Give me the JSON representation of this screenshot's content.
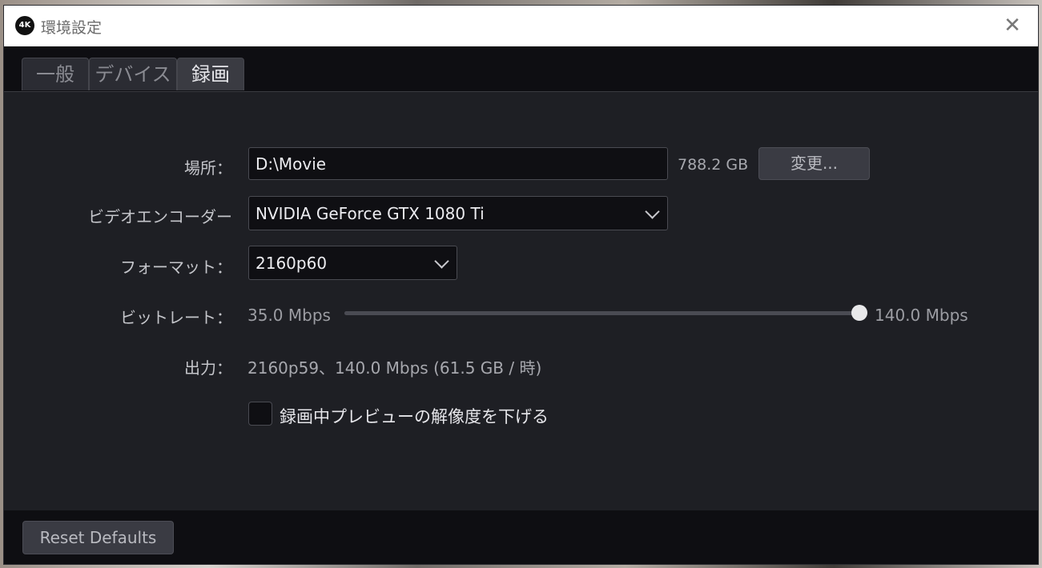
{
  "window": {
    "app_icon_text": "4K",
    "title": "環境設定",
    "close_glyph": "✕"
  },
  "tabs": [
    {
      "label": "一般",
      "active": false
    },
    {
      "label": "デバイス",
      "active": false
    },
    {
      "label": "録画",
      "active": true
    }
  ],
  "form": {
    "location": {
      "label": "場所：",
      "value": "D:\\Movie",
      "free_space": "788.2 GB",
      "change_button": "変更..."
    },
    "encoder": {
      "label": "ビデオエンコーダー",
      "value": "NVIDIA GeForce GTX 1080 Ti"
    },
    "format": {
      "label": "フォーマット：",
      "value": "2160p60"
    },
    "bitrate": {
      "label": "ビットレート：",
      "min_label": "35.0 Mbps",
      "max_label": "140.0 Mbps",
      "value_fraction": 1.0
    },
    "output": {
      "label": "出力：",
      "value": "2160p59、140.0 Mbps (61.5 GB / 時)"
    },
    "reduce_preview": {
      "label": "録画中プレビューの解像度を下げる",
      "checked": false
    }
  },
  "footer": {
    "reset_button": "Reset Defaults"
  },
  "colors": {
    "background": "#1e1f24",
    "bar": "#0e0e12",
    "field": "#0f0f13",
    "button": "#3a3b43",
    "text": "#e6e6ea",
    "muted": "#a7a8ae"
  },
  "icons": {
    "close": "close-icon",
    "dropdown": "chevron-down-icon",
    "app": "app-logo-icon"
  }
}
